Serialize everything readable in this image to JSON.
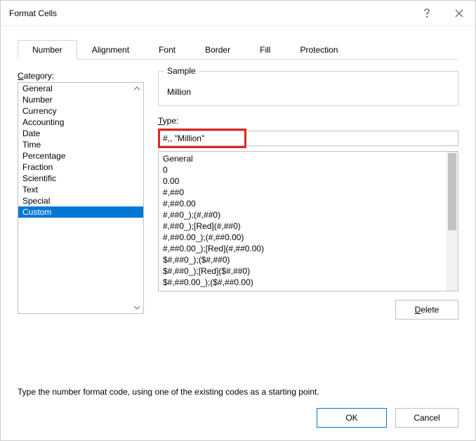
{
  "title": "Format Cells",
  "tabs": [
    "Number",
    "Alignment",
    "Font",
    "Border",
    "Fill",
    "Protection"
  ],
  "active_tab": 0,
  "category_label": "Category:",
  "categories": [
    "General",
    "Number",
    "Currency",
    "Accounting",
    "Date",
    "Time",
    "Percentage",
    "Fraction",
    "Scientific",
    "Text",
    "Special",
    "Custom"
  ],
  "selected_category_index": 11,
  "sample_label": "Sample",
  "sample_value": " Million",
  "type_label": "Type:",
  "type_value": "#,, \"Million\"",
  "formats": [
    "General",
    "0",
    "0.00",
    "#,##0",
    "#,##0.00",
    "#,##0_);(#,##0)",
    "#,##0_);[Red](#,##0)",
    "#,##0.00_);(#,##0.00)",
    "#,##0.00_);[Red](#,##0.00)",
    "$#,##0_);($#,##0)",
    "$#,##0_);[Red]($#,##0)",
    "$#,##0.00_);($#,##0.00)"
  ],
  "delete_label": "Delete",
  "hint_text": "Type the number format code, using one of the existing codes as a starting point.",
  "ok_label": "OK",
  "cancel_label": "Cancel"
}
